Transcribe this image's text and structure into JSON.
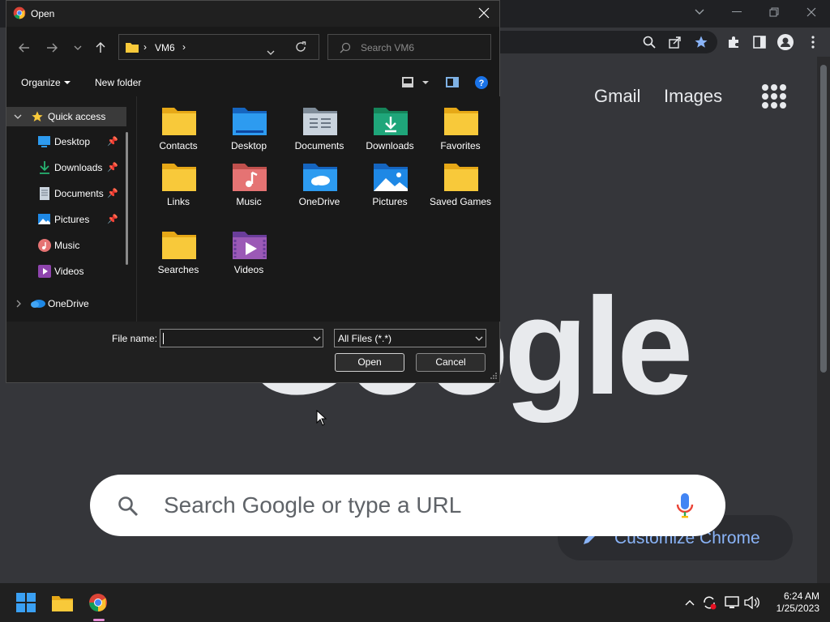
{
  "colors": {
    "chrome_bg": "#35363a",
    "dialog_bg": "#191919",
    "accent_blue": "#0078d4",
    "folder_yellow": "#f8c93a",
    "chrome_link_blue": "#8ab4f8"
  },
  "dialog": {
    "title": "Open",
    "address": {
      "crumbs": [
        "VM6"
      ]
    },
    "search_placeholder": "Search VM6",
    "commands": {
      "organize": "Organize",
      "new_folder": "New folder"
    },
    "sidebar": [
      {
        "label": "Quick access",
        "icon": "star-icon",
        "pinned": false
      },
      {
        "label": "Desktop",
        "icon": "desktop-icon",
        "pinned": true
      },
      {
        "label": "Downloads",
        "icon": "download-icon",
        "pinned": true
      },
      {
        "label": "Documents",
        "icon": "document-icon",
        "pinned": true
      },
      {
        "label": "Pictures",
        "icon": "pictures-icon",
        "pinned": true
      },
      {
        "label": "Music",
        "icon": "music-icon",
        "pinned": false
      },
      {
        "label": "Videos",
        "icon": "videos-icon",
        "pinned": false
      },
      {
        "label": "OneDrive",
        "icon": "onedrive-icon",
        "pinned": false
      }
    ],
    "folders": [
      {
        "name": "Contacts",
        "icon": "folder-icon"
      },
      {
        "name": "Desktop",
        "icon": "desktop-folder-icon"
      },
      {
        "name": "Documents",
        "icon": "documents-folder-icon"
      },
      {
        "name": "Downloads",
        "icon": "downloads-folder-icon"
      },
      {
        "name": "Favorites",
        "icon": "folder-icon"
      },
      {
        "name": "Links",
        "icon": "folder-icon"
      },
      {
        "name": "Music",
        "icon": "music-folder-icon"
      },
      {
        "name": "OneDrive",
        "icon": "onedrive-folder-icon"
      },
      {
        "name": "Pictures",
        "icon": "pictures-folder-icon"
      },
      {
        "name": "Saved Games",
        "icon": "folder-icon"
      },
      {
        "name": "Searches",
        "icon": "folder-icon"
      },
      {
        "name": "Videos",
        "icon": "videos-folder-icon"
      }
    ],
    "file_name_label": "File name:",
    "file_name_value": "",
    "file_type": "All Files (*.*)",
    "open_label": "Open",
    "cancel_label": "Cancel"
  },
  "chrome": {
    "gmail": "Gmail",
    "images": "Images",
    "search_placeholder": "Search Google or type a URL",
    "customize": "Customize Chrome"
  },
  "taskbar": {
    "time": "6:24 AM",
    "date": "1/25/2023"
  }
}
